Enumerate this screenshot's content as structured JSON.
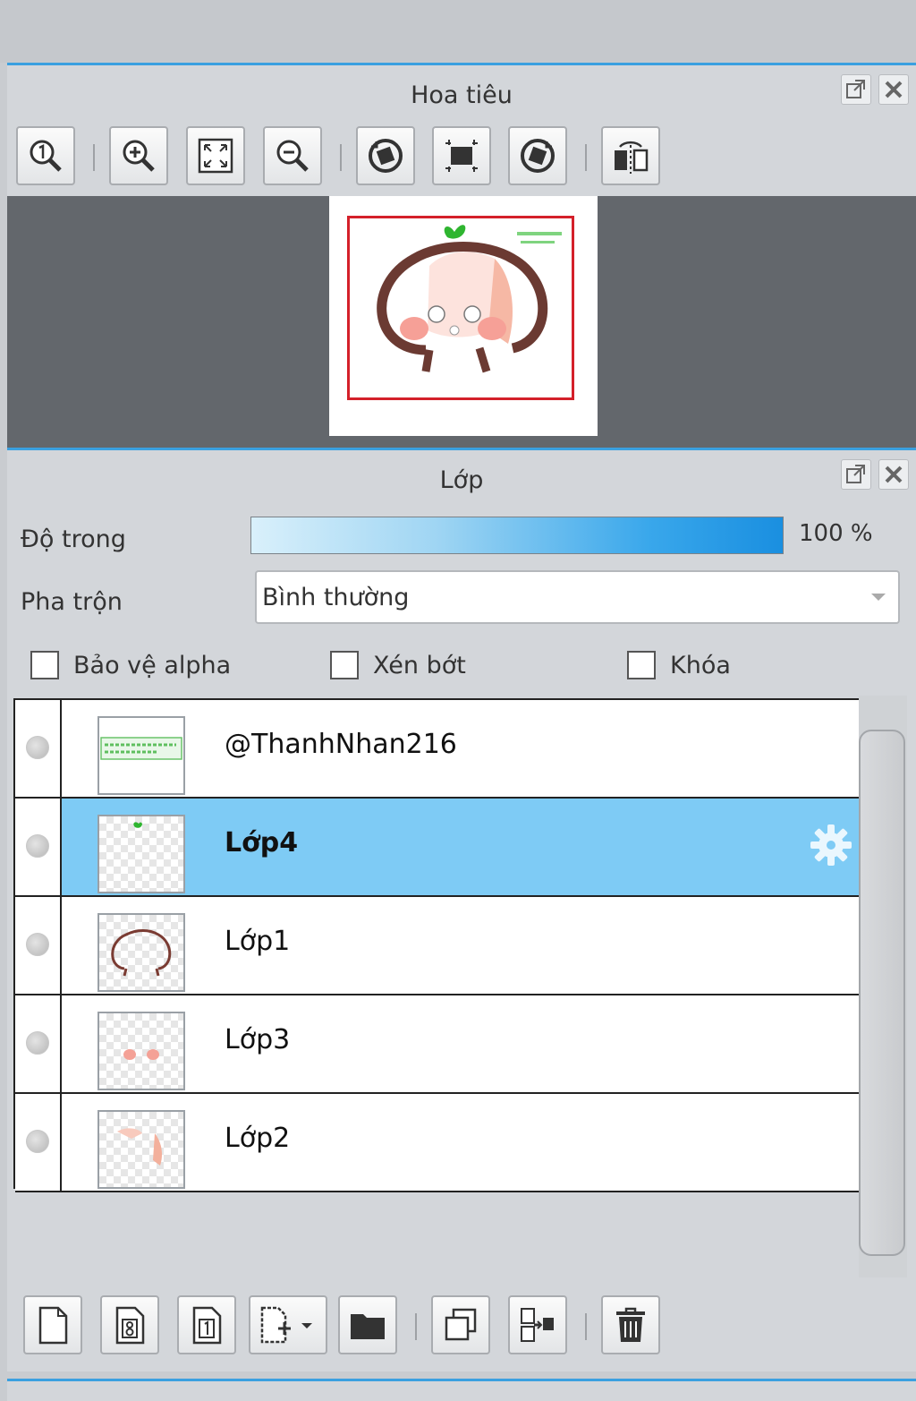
{
  "navigator": {
    "title": "Hoa tiêu",
    "tools": [
      {
        "icon": "zoom-actual-icon"
      },
      {
        "icon": "zoom-in-icon"
      },
      {
        "icon": "fit-screen-icon"
      },
      {
        "icon": "zoom-out-icon"
      },
      {
        "icon": "rotate-left-icon"
      },
      {
        "icon": "reset-view-icon"
      },
      {
        "icon": "rotate-right-icon"
      },
      {
        "icon": "flip-horizontal-icon"
      }
    ]
  },
  "layers_panel": {
    "title": "Lớp",
    "opacity_label": "Độ trong",
    "opacity_value": "100 %",
    "opacity_fraction": 1.0,
    "blend_label": "Pha trộn",
    "blend_value": "Bình thường",
    "checkboxes": {
      "protect_alpha": "Bảo vệ alpha",
      "clipping": "Xén bớt",
      "lock": "Khóa"
    },
    "layers": [
      {
        "name": "@ThanhNhan216",
        "selected": false
      },
      {
        "name": "Lớp4",
        "selected": true
      },
      {
        "name": "Lớp1",
        "selected": false
      },
      {
        "name": "Lớp3",
        "selected": false
      },
      {
        "name": "Lớp2",
        "selected": false
      }
    ],
    "bottom_tools": [
      {
        "icon": "new-layer-icon"
      },
      {
        "icon": "new-8bit-layer-icon"
      },
      {
        "icon": "new-1bit-layer-icon"
      },
      {
        "icon": "add-layer-dropdown-icon"
      },
      {
        "icon": "folder-icon"
      },
      {
        "icon": "duplicate-layer-icon"
      },
      {
        "icon": "merge-down-icon"
      },
      {
        "icon": "trash-icon"
      }
    ]
  },
  "colors": {
    "accent": "#3aa0e0",
    "selected_row": "#7ecbf5",
    "panel_bg": "#d3d6da"
  }
}
